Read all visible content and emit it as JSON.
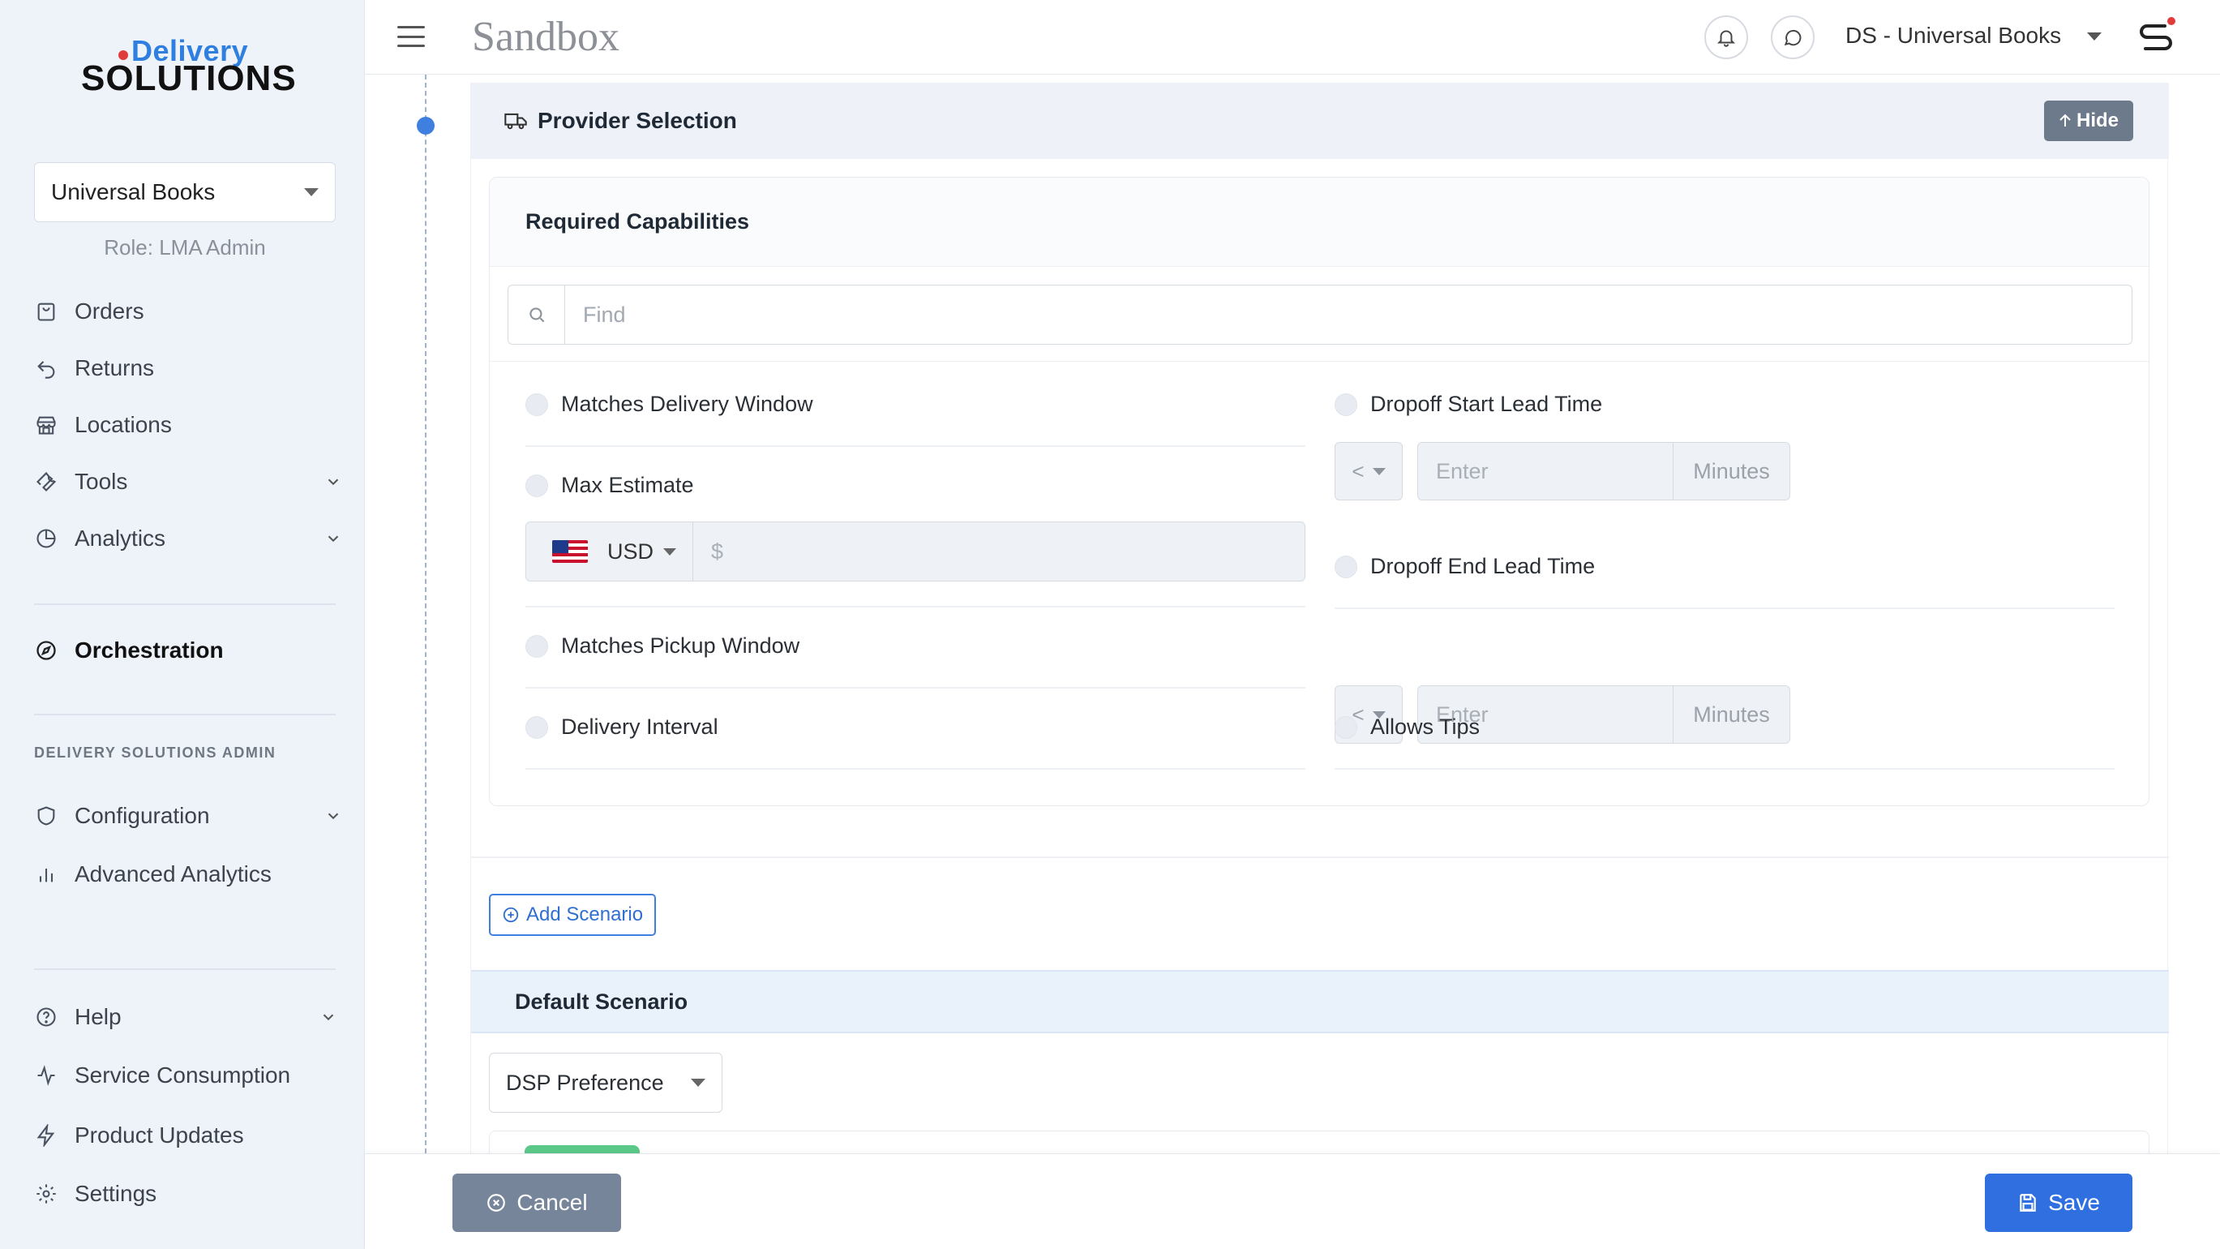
{
  "brand": {
    "line1": "Delivery",
    "line2": "SOLUTIONS"
  },
  "sidebar": {
    "account": "Universal Books",
    "role": "Role: LMA Admin",
    "items": [
      {
        "label": "Orders",
        "icon": "bag-icon"
      },
      {
        "label": "Returns",
        "icon": "return-icon"
      },
      {
        "label": "Locations",
        "icon": "store-icon"
      },
      {
        "label": "Tools",
        "icon": "wrench-icon"
      },
      {
        "label": "Analytics",
        "icon": "pie-chart-icon"
      },
      {
        "label": "Orchestration",
        "icon": "compass-icon"
      },
      {
        "label": "Configuration",
        "icon": "shield-icon"
      },
      {
        "label": "Advanced Analytics",
        "icon": "bar-chart-icon"
      },
      {
        "label": "Help",
        "icon": "help-icon"
      },
      {
        "label": "Service Consumption",
        "icon": "activity-icon"
      },
      {
        "label": "Product Updates",
        "icon": "lightning-icon"
      },
      {
        "label": "Settings",
        "icon": "gear-icon"
      }
    ],
    "admin_section": "DELIVERY SOLUTIONS ADMIN"
  },
  "topbar": {
    "env": "Sandbox",
    "org": "DS - Universal Books"
  },
  "provider_selection": {
    "title": "Provider Selection",
    "hide_label": "Hide",
    "capabilities": {
      "title": "Required Capabilities",
      "find_placeholder": "Find",
      "left": [
        "Matches Delivery Window",
        "Max Estimate",
        "Matches Pickup Window",
        "Delivery Interval"
      ],
      "right": [
        "Dropoff Start Lead Time",
        "Dropoff End Lead Time",
        "Allows Tips"
      ],
      "currency": "USD",
      "currency_symbol": "$",
      "operator": "<",
      "enter_placeholder": "Enter",
      "unit": "Minutes"
    },
    "add_scenario": "Add Scenario",
    "default_scenario": "Default Scenario",
    "dsp_preference": "DSP Preference"
  },
  "footer": {
    "cancel": "Cancel",
    "save": "Save"
  },
  "colors": {
    "accent": "#2f6fe0",
    "sidebar_bg": "#eef3fa",
    "cancel_bg": "#76859a"
  }
}
